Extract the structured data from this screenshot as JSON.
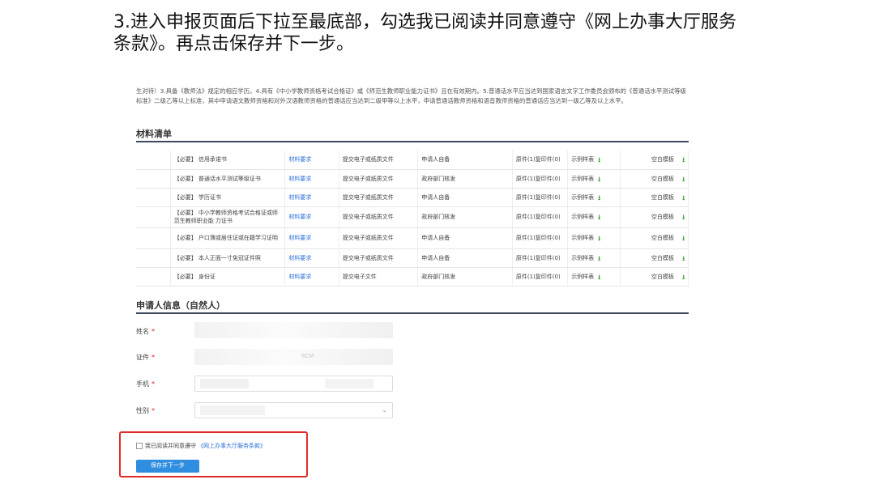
{
  "instruction": {
    "line1": "3.进入申报页面后下拉至最底部，勾选我已阅读并同意遵守《网上办事大厅服务",
    "line2": "条款》。再点击保存并下一步。"
  },
  "intro_text": "生对待）3.具备《教师法》规定的相应学历。4.具有《中小学教师资格考试合格证》或《师范生教师职业能力证书》且在有效期内。5.普通话水平应当达到国家语言文字工作委员会颁布的《普通话水平测试等级标准》二级乙等以上标准，其中申请语文教师资格和对外汉语教师资格的普通话应当达到二级甲等以上水平，申请普通话教师资格和语音教师资格的普通话应当达到一级乙等及以上水平。",
  "materials": {
    "title": "材料清单",
    "rows": [
      {
        "name": "【必要】 信用承诺书",
        "req": "材料要求",
        "type": "提交电子或纸质文件",
        "source": "申请人自备",
        "copies": "原件(1)复印件(0)",
        "sample": "示例样表",
        "blank": "空白模板"
      },
      {
        "name": "【必要】 普通话水平测试等级证书",
        "req": "材料要求",
        "type": "提交电子或纸质文件",
        "source": "政府部门核发",
        "copies": "原件(1)复印件(0)",
        "sample": "示例样表",
        "blank": "空白模板"
      },
      {
        "name": "【必要】 学历证书",
        "req": "材料要求",
        "type": "提交电子或纸质文件",
        "source": "申请人自备",
        "copies": "原件(1)复印件(0)",
        "sample": "示例样表",
        "blank": "空白模板"
      },
      {
        "name": "【必要】 中小学教师资格考试合格证或师范生教师职业能 力证书",
        "req": "材料要求",
        "type": "提交电子或纸质文件",
        "source": "政府部门核发",
        "copies": "原件(1)复印件(0)",
        "sample": "示例样表",
        "blank": "空白模板"
      },
      {
        "name": "【必要】 户口簿或居住证或在籍学习证明",
        "req": "材料要求",
        "type": "提交电子或纸质文件",
        "source": "申请人自备",
        "copies": "原件(1)复印件(0)",
        "sample": "示例样表",
        "blank": "空白模板"
      },
      {
        "name": "【必要】 本人正面一寸免冠证件照",
        "req": "材料要求",
        "type": "提交电子或纸质文件",
        "source": "申请人自备",
        "copies": "原件(1)复印件(0)",
        "sample": "示例样表",
        "blank": "空白模板"
      },
      {
        "name": "【必要】 身份证",
        "req": "材料要求",
        "type": "提交电子文件",
        "source": "政府部门核发",
        "copies": "原件(1)复印件(0)",
        "sample": "示例样表",
        "blank": "空白模板"
      }
    ]
  },
  "applicant": {
    "title": "申请人信息（自然人）",
    "name_label": "姓名",
    "id_label": "证件",
    "id_partial": "8CM",
    "phone_label": "手机",
    "gender_label": "性别",
    "required_mark": "*"
  },
  "agreement": {
    "text": "我已阅读并同意遵守",
    "link": "《网上办事大厅服务条款》",
    "checked": false
  },
  "save_button": "保存并下一步",
  "colors": {
    "link": "#2a6fd6",
    "button": "#2f8ee0",
    "highlight_frame": "#e12b2b",
    "download_icon": "#3aa03a"
  }
}
